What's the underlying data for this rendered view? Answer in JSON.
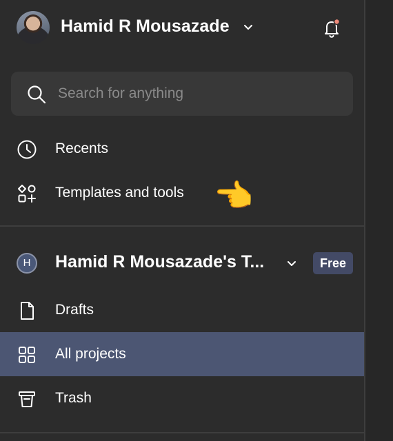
{
  "header": {
    "user_name": "Hamid R Mousazade",
    "notification_badge_color": "#f08a7a"
  },
  "search": {
    "placeholder": "Search for anything",
    "value": ""
  },
  "nav": {
    "recents_label": "Recents",
    "templates_label": "Templates and tools",
    "pointer_emoji": "👈"
  },
  "team": {
    "initial": "H",
    "name": "Hamid R Mousazade's T...",
    "plan_badge": "Free"
  },
  "team_nav": {
    "drafts_label": "Drafts",
    "all_projects_label": "All projects",
    "trash_label": "Trash",
    "active_item": "All projects"
  },
  "colors": {
    "background": "#2c2c2c",
    "search_bg": "#383838",
    "active_row": "#4c5673",
    "badge_bg": "#434a66",
    "divider": "#3e3e3e"
  }
}
